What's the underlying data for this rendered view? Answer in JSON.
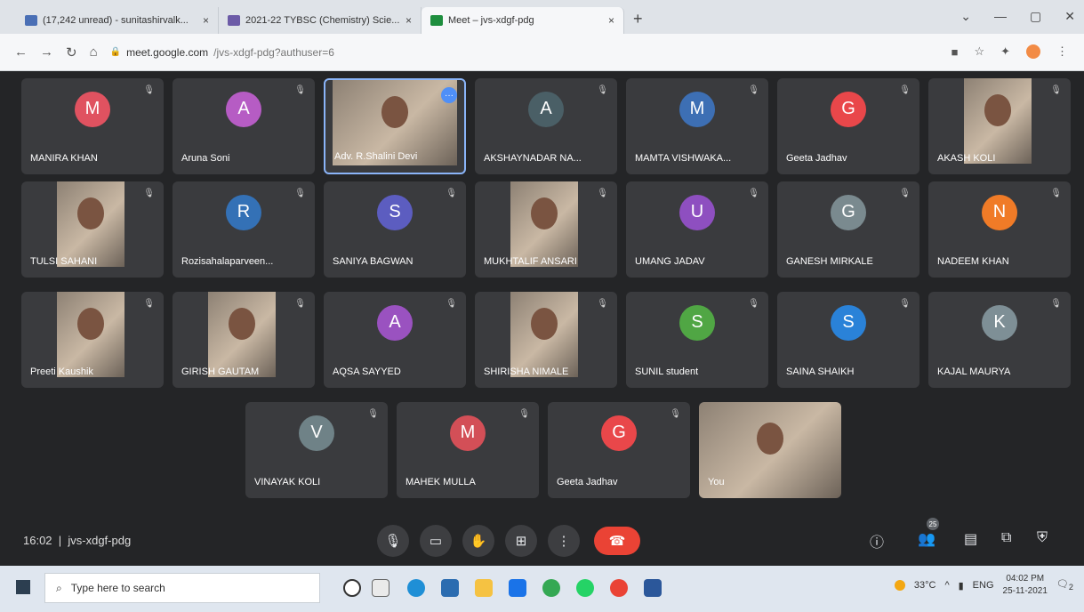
{
  "browser": {
    "tabs": [
      {
        "label": "(17,242 unread) - sunitashirvalk...",
        "close": "×",
        "fav_color": "#4a6fb5"
      },
      {
        "label": "2021-22 TYBSC (Chemistry) Scie...",
        "close": "×",
        "fav_color": "#6c5ba7"
      },
      {
        "label": "Meet – jvs-xdgf-pdg",
        "close": "×",
        "fav_color": "#1e8e3e"
      }
    ],
    "new_tab": "+",
    "url_host": "meet.google.com",
    "url_path": "/jvs-xdgf-pdg?authuser=6"
  },
  "meet": {
    "tiles": [
      {
        "name": "MANIRA KHAN",
        "initial": "M",
        "color": "#e05260"
      },
      {
        "name": "Aruna Soni",
        "initial": "A",
        "color": "#b65cc4"
      },
      {
        "name": "Adv. R.Shalini Devi",
        "initial": "",
        "color": ""
      },
      {
        "name": "AKSHAYNADAR NA...",
        "initial": "A",
        "color": "#4a5f66"
      },
      {
        "name": "MAMTA VISHWAKA...",
        "initial": "M",
        "color": "#3d6fb4"
      },
      {
        "name": "Geeta Jadhav",
        "initial": "G",
        "color": "#e9474a"
      },
      {
        "name": "AKASH KOLI",
        "initial": "",
        "color": ""
      },
      {
        "name": "TULSI SAHANI",
        "initial": "",
        "color": ""
      },
      {
        "name": "Rozisahalaparveen...",
        "initial": "R",
        "color": "#3471b6"
      },
      {
        "name": "SANIYA BAGWAN",
        "initial": "S",
        "color": "#5c5dc0"
      },
      {
        "name": "MUKHTALIF ANSARI",
        "initial": "",
        "color": ""
      },
      {
        "name": "UMANG JADAV",
        "initial": "U",
        "color": "#8e4fc0"
      },
      {
        "name": "GANESH MIRKALE",
        "initial": "G",
        "color": "#7a8a8f"
      },
      {
        "name": "NADEEM KHAN",
        "initial": "N",
        "color": "#f07b27"
      },
      {
        "name": "Preeti Kaushik",
        "initial": "",
        "color": ""
      },
      {
        "name": "GIRISH GAUTAM",
        "initial": "",
        "color": ""
      },
      {
        "name": "AQSA SAYYED",
        "initial": "A",
        "color": "#9a52c0"
      },
      {
        "name": "SHIRISHA NIMALE",
        "initial": "",
        "color": ""
      },
      {
        "name": "SUNIL student",
        "initial": "S",
        "color": "#50a644"
      },
      {
        "name": "SAINA SHAIKH",
        "initial": "S",
        "color": "#2a82d8"
      },
      {
        "name": "KAJAL MAURYA",
        "initial": "K",
        "color": "#7e8f96"
      },
      {
        "name": "VINAYAK KOLI",
        "initial": "V",
        "color": "#6f8287"
      },
      {
        "name": "MAHEK MULLA",
        "initial": "M",
        "color": "#d34f57"
      },
      {
        "name": "Geeta Jadhav",
        "initial": "G",
        "color": "#e9474a"
      },
      {
        "name": "You",
        "initial": "",
        "color": ""
      }
    ],
    "more_options": "···",
    "time": "16:02",
    "meeting_code": "jvs-xdgf-pdg",
    "participants_count": "25"
  },
  "taskbar": {
    "search_placeholder": "Type here to search",
    "temperature": "33°C",
    "lang": "ENG",
    "clock_time": "04:02 PM",
    "clock_date": "25-11-2021",
    "notif_count": "2"
  }
}
